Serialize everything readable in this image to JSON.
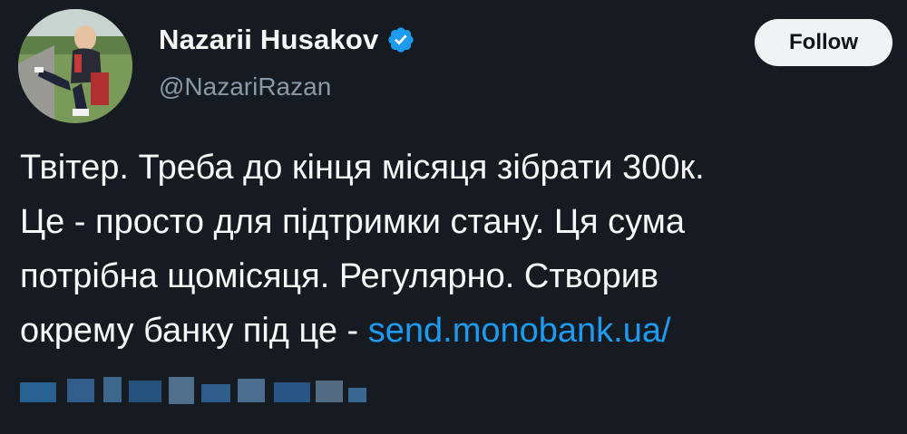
{
  "author": {
    "display_name": "Nazarii Husakov",
    "handle": "@NazariRazan",
    "verified": true,
    "avatar_icon": "profile-photo"
  },
  "follow_button": {
    "label": "Follow"
  },
  "tweet": {
    "lines": [
      "Твітер. Треба до кінця місяця зібрати 300к.",
      "Це - просто для підтримки стану. Ця сума",
      "потрібна щомісяця. Регулярно. Створив"
    ],
    "last_line_prefix": "окрему банку під це - ",
    "link_text": "send.monobank.ua/"
  },
  "colors": {
    "background": "#161b22",
    "text": "#f7f9f9",
    "secondary": "#8b98a5",
    "link": "#1d9bf0",
    "verified_badge": "#1d9bf0"
  }
}
